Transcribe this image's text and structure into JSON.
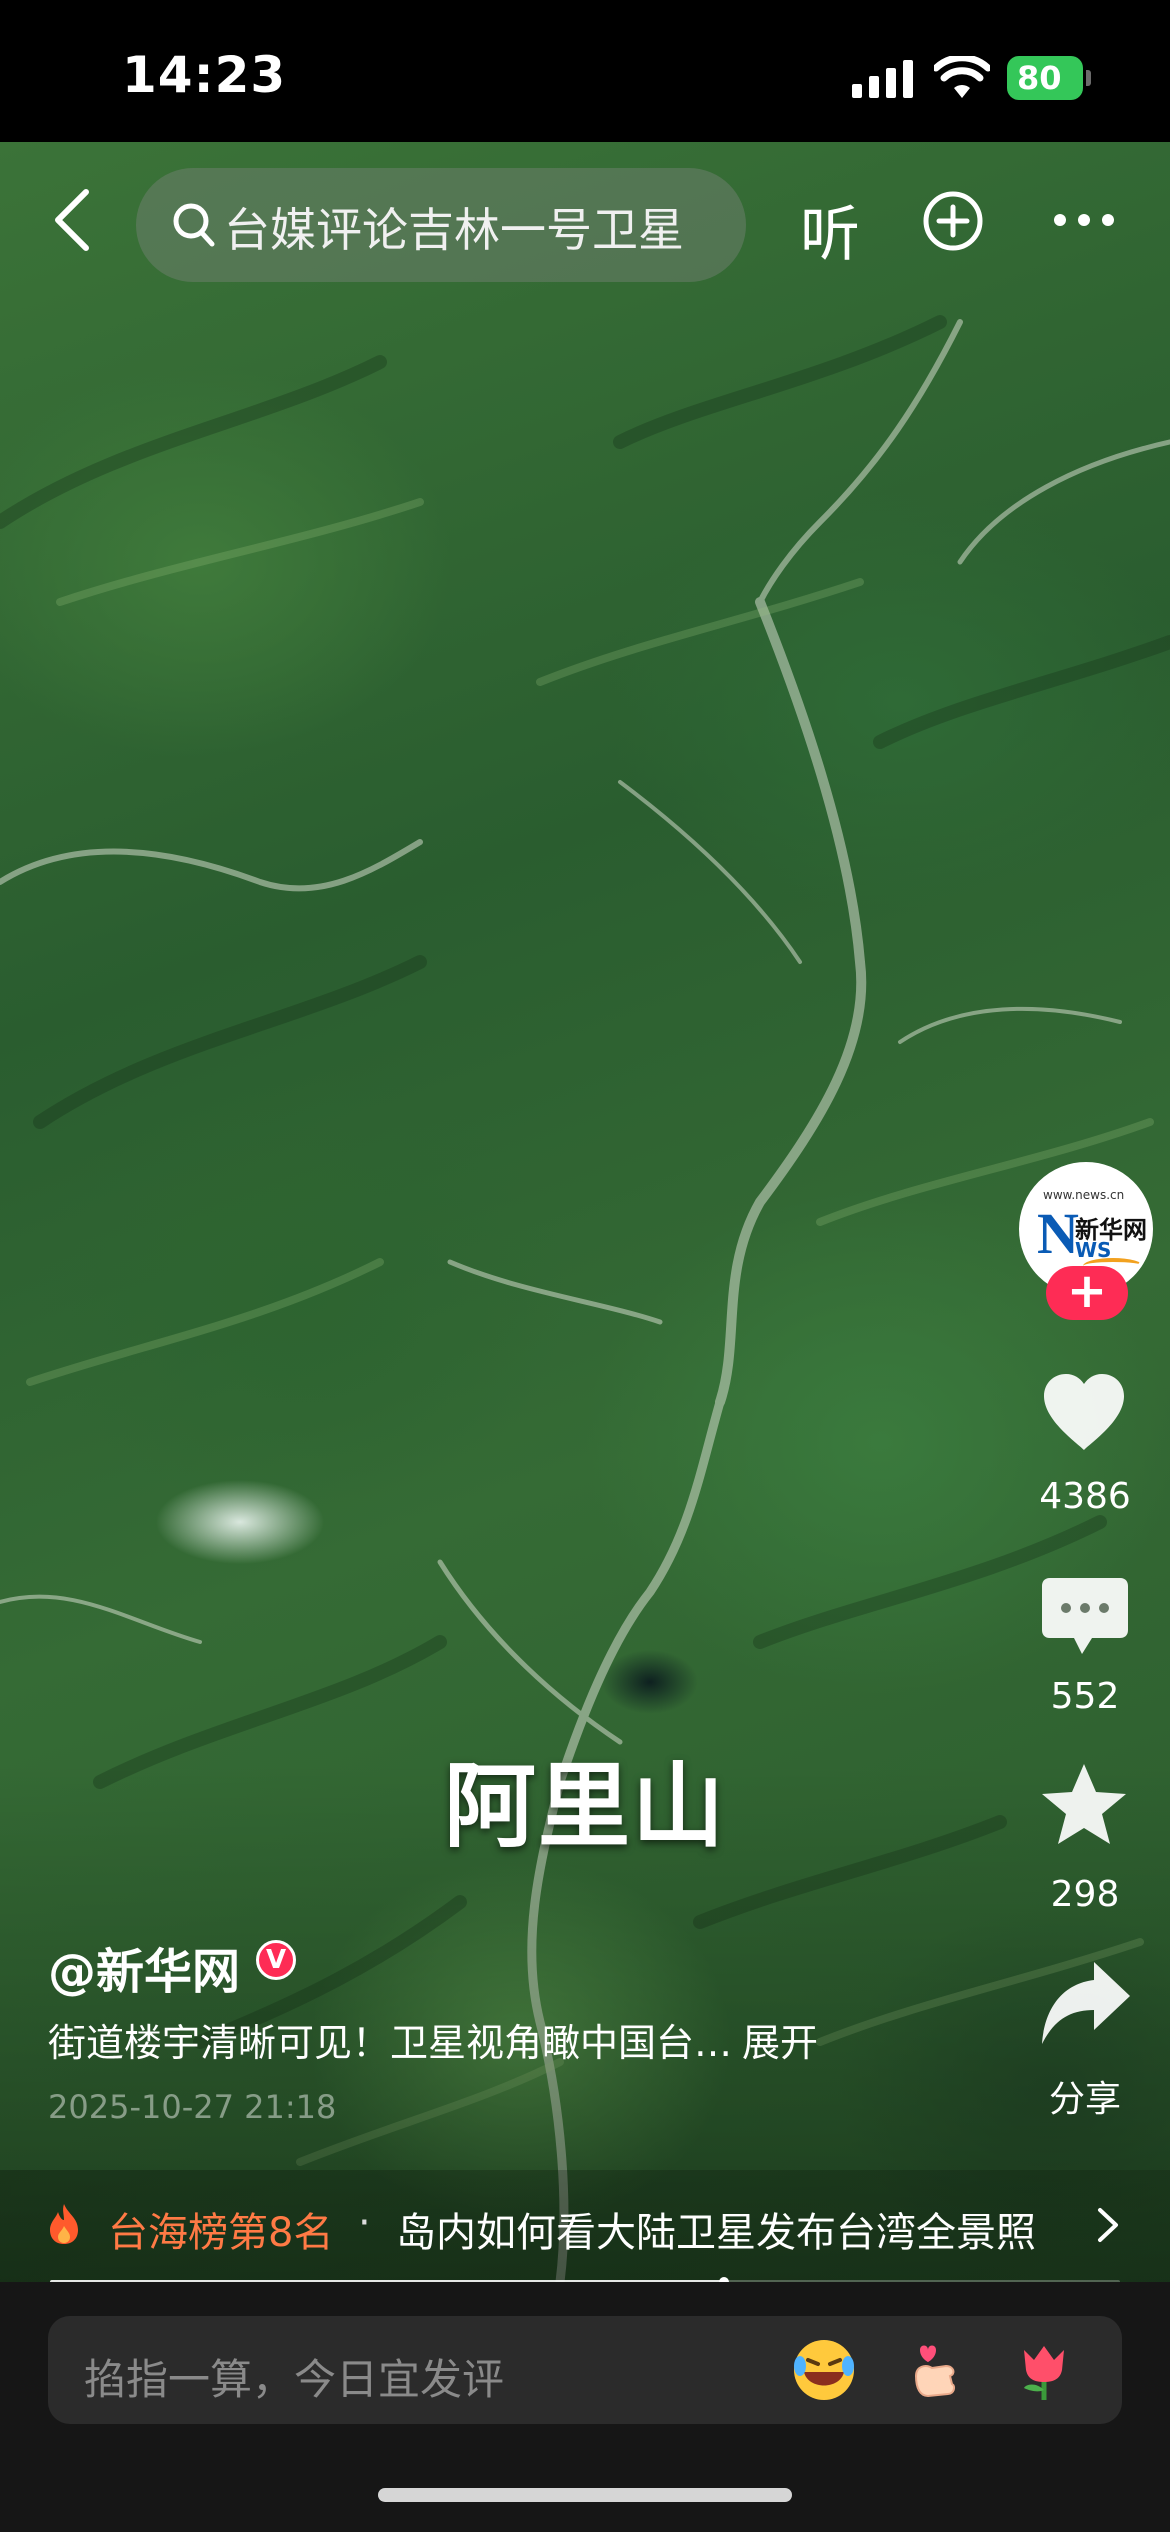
{
  "status_bar": {
    "time": "14:23",
    "battery": "80"
  },
  "nav": {
    "back_icon": "chevron-left-icon",
    "search_text": "台媒评论吉林一号卫星",
    "listen_label": "听",
    "add_icon": "plus-circle-icon",
    "more_icon": "more-icon"
  },
  "video": {
    "caption": "阿里山"
  },
  "rail": {
    "avatar_text": {
      "small": "www.news.cn",
      "letter": "N",
      "cn": "新华网",
      "ws": "WS"
    },
    "follow_label": "+",
    "likes": "4386",
    "comments": "552",
    "favorites": "298",
    "share_label": "分享"
  },
  "post": {
    "author": "@新华网",
    "verified_label": "V",
    "description": "街道楼宇清晰可见！卫星视角瞰中国台…",
    "expand_label": "展开",
    "date": "2025-10-27 21:18"
  },
  "hot": {
    "rank": "台海榜第8名",
    "separator": "·",
    "title": "岛内如何看大陆卫星发布台湾全景照"
  },
  "playback": {
    "progress": 0.63
  },
  "comment_bar": {
    "placeholder": "掐指一算，今日宜发评",
    "emojis": [
      "laughing-emoji",
      "finger-heart-emoji",
      "tulip-emoji"
    ]
  },
  "colors": {
    "accent_red": "#fe2c55",
    "hot_orange": "#ff7a45",
    "battery_green": "#34c759"
  }
}
